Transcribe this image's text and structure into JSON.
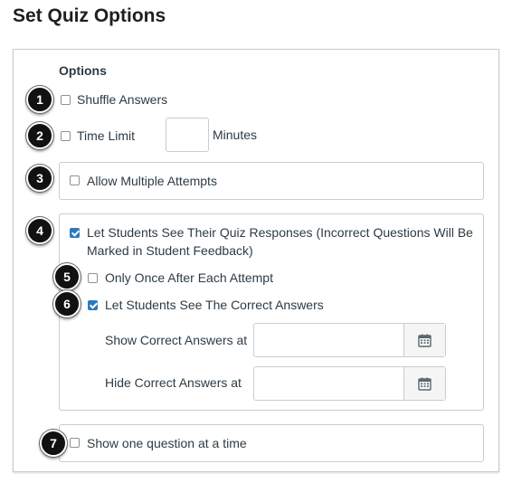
{
  "page": {
    "title": "Set Quiz Options"
  },
  "options": {
    "heading": "Options",
    "shuffle_answers": {
      "label": "Shuffle Answers",
      "checked": false
    },
    "time_limit": {
      "label": "Time Limit",
      "checked": false,
      "value": "",
      "unit": "Minutes"
    },
    "allow_multiple_attempts": {
      "label": "Allow Multiple Attempts",
      "checked": false
    },
    "see_responses": {
      "label_line1": "Let Students See Their Quiz Responses (Incorrect Questions Will Be",
      "label_line2": "Marked in Student Feedback)",
      "checked": true
    },
    "only_once": {
      "label": "Only Once After Each Attempt",
      "checked": false
    },
    "see_correct": {
      "label": "Let Students See The Correct Answers",
      "checked": true
    },
    "show_correct_at": {
      "label": "Show Correct Answers at",
      "value": "",
      "icon": "calendar-icon"
    },
    "hide_correct_at": {
      "label": "Hide Correct Answers at",
      "value": "",
      "icon": "calendar-icon"
    },
    "one_question": {
      "label": "Show one question at a time",
      "checked": false
    }
  },
  "badges": [
    "1",
    "2",
    "3",
    "4",
    "5",
    "6",
    "7"
  ],
  "colors": {
    "accent": "#2b7abc",
    "text": "#2d3b45",
    "border": "#c7cdd1",
    "badge": "#111111"
  }
}
